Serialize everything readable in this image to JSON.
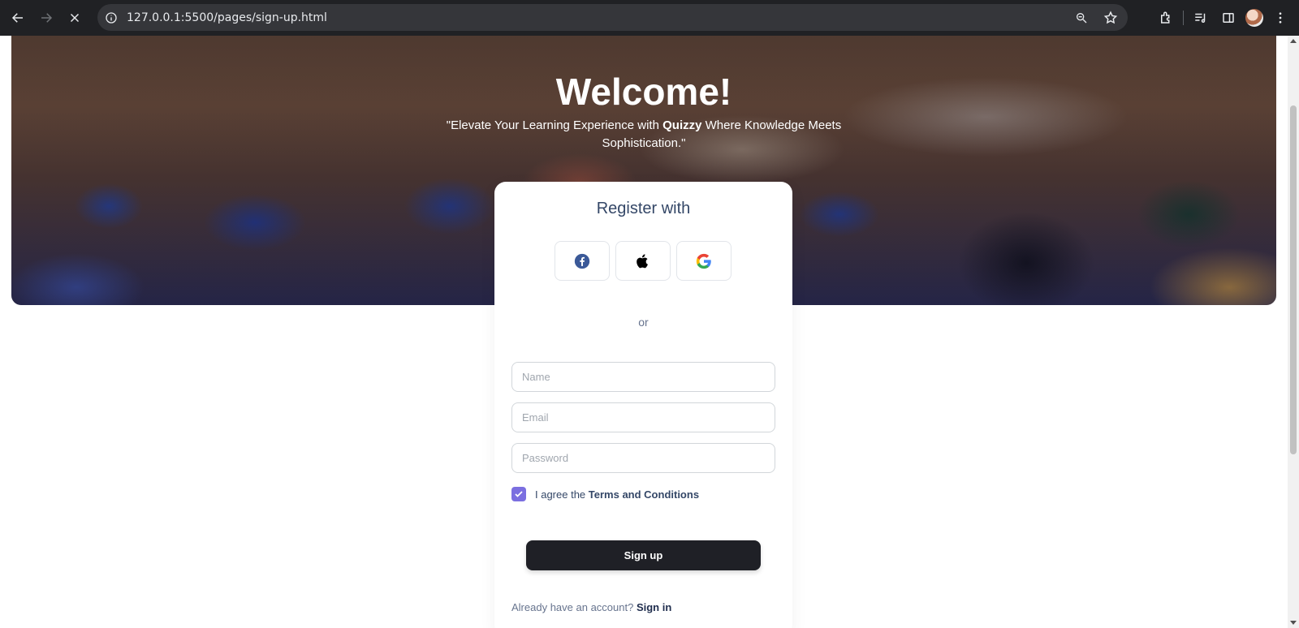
{
  "browser": {
    "url": "127.0.0.1:5500/pages/sign-up.html",
    "icons": [
      "back-icon",
      "forward-icon",
      "stop-icon",
      "site-info-icon",
      "zoom-icon",
      "bookmark-star-icon",
      "extensions-icon",
      "media-controls-icon",
      "side-panel-icon",
      "profile-avatar",
      "menu-kebab-icon"
    ]
  },
  "hero": {
    "title": "Welcome!",
    "subtitle_prefix": "\"Elevate Your Learning Experience with ",
    "subtitle_brand": "Quizzy",
    "subtitle_suffix": " Where Knowledge Meets Sophistication.\""
  },
  "card": {
    "title": "Register with",
    "social": [
      {
        "name": "facebook",
        "icon": "facebook-icon"
      },
      {
        "name": "apple",
        "icon": "apple-icon"
      },
      {
        "name": "google",
        "icon": "google-icon"
      }
    ],
    "or_label": "or",
    "name_placeholder": "Name",
    "email_placeholder": "Email",
    "password_placeholder": "Password",
    "terms_prefix": "I agree the ",
    "terms_link": "Terms and Conditions",
    "terms_checked": true,
    "signup_label": "Sign up",
    "signin_prefix": "Already have an account? ",
    "signin_link": "Sign in"
  },
  "colors": {
    "checkbox": "#7b6fe0",
    "button": "#1f2026",
    "heading": "#344767"
  }
}
